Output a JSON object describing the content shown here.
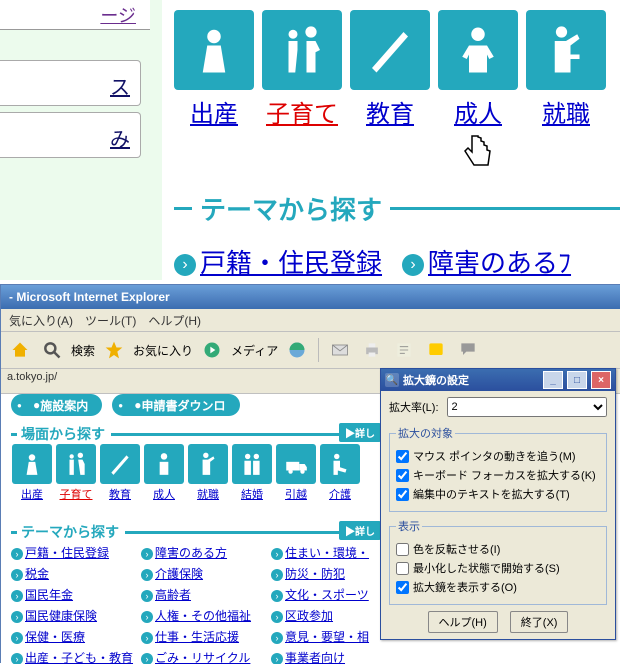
{
  "zoom": {
    "left_link1": "ージ",
    "left_box1_tail": "ス",
    "left_box2_tail": "み",
    "tiles": [
      {
        "label": "出産"
      },
      {
        "label": "子育て",
        "active": true
      },
      {
        "label": "教育"
      },
      {
        "label": "成人"
      },
      {
        "label": "就職"
      }
    ],
    "section_title": "テーマから探す",
    "section_links": [
      "戸籍・住民登録",
      "障害のあるﾌ"
    ]
  },
  "ie": {
    "title": "- Microsoft Internet Explorer",
    "menu": [
      "気に入り(A)",
      "ツール(T)",
      "ヘルプ(H)"
    ],
    "toolbar": {
      "search": "検索",
      "fav": "お気に入り",
      "media": "メディア"
    },
    "address": "a.tokyo.jp/"
  },
  "page": {
    "pills": [
      "施設案内",
      "申請書ダウンロ"
    ],
    "sec1": {
      "title": "場面から探す",
      "more": "▶詳し"
    },
    "mini_tiles": [
      {
        "label": "出産"
      },
      {
        "label": "子育て",
        "active": true
      },
      {
        "label": "教育"
      },
      {
        "label": "成人"
      },
      {
        "label": "就職"
      },
      {
        "label": "結婚"
      },
      {
        "label": "引越"
      },
      {
        "label": "介護"
      }
    ],
    "sec2": {
      "title": "テーマから探す",
      "more": "▶詳し"
    },
    "link_cols": [
      [
        "戸籍・住民登録",
        "税金",
        "国民年金",
        "国民健康保険",
        "保健・医療",
        "出産・子ども・教育"
      ],
      [
        "障害のある方",
        "介護保険",
        "高齢者",
        "人権・その他福祉",
        "仕事・生活応援",
        "ごみ・リサイクル"
      ],
      [
        "住まい・環境・",
        "防災・防犯",
        "文化・スポーツ",
        "区政参加",
        "意見・要望・相",
        "事業者向け"
      ]
    ]
  },
  "dlg": {
    "title": "拡大鏡の設定",
    "level_label": "拡大率(L):",
    "level_value": "2",
    "fs1": {
      "legend": "拡大の対象",
      "c1": {
        "checked": true,
        "label": "マウス ポインタの動きを追う(M)"
      },
      "c2": {
        "checked": true,
        "label": "キーボード フォーカスを拡大する(K)"
      },
      "c3": {
        "checked": true,
        "label": "編集中のテキストを拡大する(T)"
      }
    },
    "fs2": {
      "legend": "表示",
      "c1": {
        "checked": false,
        "label": "色を反転させる(I)"
      },
      "c2": {
        "checked": false,
        "label": "最小化した状態で開始する(S)"
      },
      "c3": {
        "checked": true,
        "label": "拡大鏡を表示する(O)"
      }
    },
    "help": "ヘルプ(H)",
    "exit": "終了(X)"
  }
}
